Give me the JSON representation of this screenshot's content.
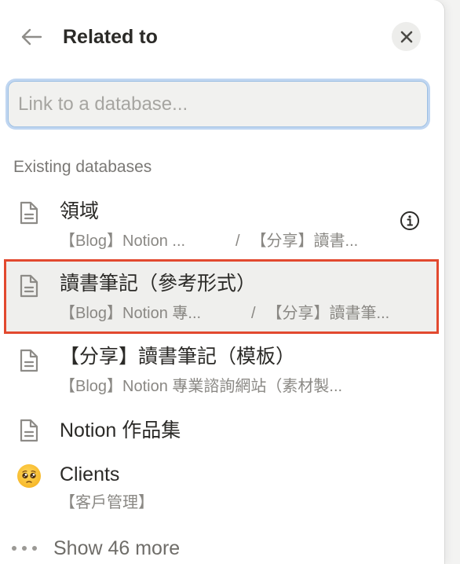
{
  "header": {
    "title": "Related to",
    "back_icon": "arrow-left-icon",
    "close_icon": "close-icon"
  },
  "search": {
    "placeholder": "Link to a database...",
    "value": ""
  },
  "section": {
    "label": "Existing databases"
  },
  "databases": [
    {
      "icon": "page-icon",
      "title": "領域",
      "sub_left": "【Blog】Notion ...",
      "sub_sep": "/",
      "sub_right": "【分享】讀書...",
      "info_icon": "info-icon"
    },
    {
      "icon": "page-icon",
      "title": "讀書筆記（參考形式）",
      "sub_left": "【Blog】Notion 專...",
      "sub_sep": "/",
      "sub_right": "【分享】讀書筆..."
    },
    {
      "icon": "page-icon",
      "title": "【分享】讀書筆記（模板）",
      "sub_left": "【Blog】Notion 專業諮詢網站（素材製..."
    },
    {
      "icon": "page-icon",
      "title": "Notion 作品集"
    },
    {
      "icon": "pleading-face-emoji",
      "title": "Clients",
      "sub_left": "【客戶管理】"
    }
  ],
  "more": {
    "icon": "ellipsis-icon",
    "label": "Show 46 more"
  },
  "colors": {
    "selection_outline": "#e2492f",
    "focus_ring": "#9cbfe3",
    "text_primary": "#2b2a27",
    "text_secondary": "#8a8884"
  }
}
